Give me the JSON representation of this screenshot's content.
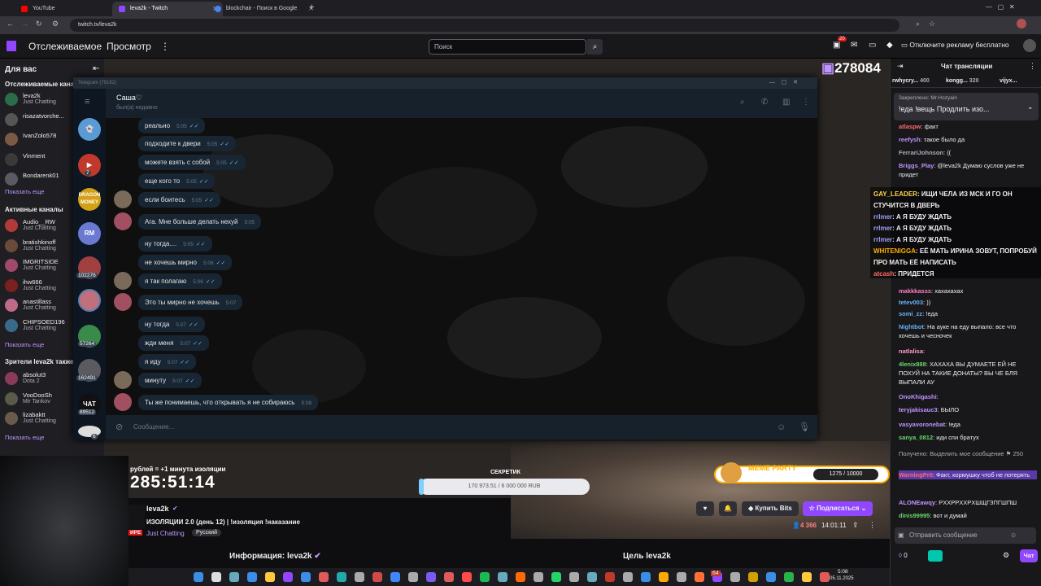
{
  "browser": {
    "tabs": [
      {
        "title": "YouTube",
        "color": "#ff0000"
      },
      {
        "title": "leva2k - Twitch",
        "color": "#9147ff"
      },
      {
        "title": "blockchair - Поиск в Google",
        "color": "#4285f4"
      }
    ],
    "url": "twitch.tv/leva2k"
  },
  "nav": {
    "following": "Отслеживаемое",
    "browse": "Просмотр",
    "search_placeholder": "Поиск",
    "notif_count": "20",
    "adfree": "Отключите рекламу бесплатно"
  },
  "sidebar": {
    "title": "Для вас",
    "followed_header": "Отслеживаемые кана",
    "followed": [
      {
        "name": "leva2k",
        "game": "Just Chatting",
        "color": "#2b6d4a"
      },
      {
        "name": "risazatvorche...",
        "game": "",
        "color": "#555"
      },
      {
        "name": "IvanZolo578",
        "game": "",
        "color": "#7a5a44"
      },
      {
        "name": "Vinment",
        "game": "",
        "color": "#3a3a3a"
      },
      {
        "name": "Bondarenk01",
        "game": "",
        "color": "#5a5a60"
      }
    ],
    "show_more": "Показать еще",
    "active_header": "Активные каналы",
    "active": [
      {
        "name": "Audio__RW",
        "game": "Just Chatting",
        "color": "#b03a3a"
      },
      {
        "name": "bratishkinoff",
        "game": "Just Chatting",
        "color": "#6a4a3a"
      },
      {
        "name": "IMGRITSIDE",
        "game": "Just Chatting",
        "color": "#a04a6a"
      },
      {
        "name": "ihw666",
        "game": "Just Chatting",
        "color": "#7a2020"
      },
      {
        "name": "anastillass",
        "game": "Just Chatting",
        "color": "#c06a8a"
      },
      {
        "name": "CHIPSOED196",
        "game": "Just Chatting",
        "color": "#3a6a8a"
      }
    ],
    "show_more2": "Показать еще",
    "also_header": "Зрители leva2k также",
    "also": [
      {
        "name": "absolut3",
        "game": "Dota 2",
        "color": "#8a3a5a"
      },
      {
        "name": "VooDooSh",
        "game": "Mir Tankov",
        "color": "#5a5a4a"
      },
      {
        "name": "lizabaktt",
        "game": "Just Chatting",
        "color": "#6a5a4a"
      }
    ],
    "show_more3": "Показать еще"
  },
  "telegram": {
    "window_title": "Telegram (79182)",
    "contact": "Саша♡",
    "status": "был(а) недавно",
    "left_badges": [
      "7",
      "102276",
      "57264",
      "162491",
      "89512",
      "6"
    ],
    "left_labels": [
      "RM",
      "ЧАТ"
    ],
    "messages": [
      {
        "text": "реально",
        "time": "5:05",
        "side": "out"
      },
      {
        "text": "подходите к двери",
        "time": "5:05",
        "side": "out"
      },
      {
        "text": "можете взять с собой",
        "time": "5:05",
        "side": "out"
      },
      {
        "text": "еще кого то",
        "time": "5:05",
        "side": "out"
      },
      {
        "text": "если боитесь",
        "time": "5:05",
        "side": "out"
      },
      {
        "text": "Ага. Мне больше делать нехуй",
        "time": "5:05",
        "side": "in"
      },
      {
        "text": "ну тогда....",
        "time": "5:05",
        "side": "out"
      },
      {
        "text": "не хочешь мирно",
        "time": "5:06",
        "side": "out"
      },
      {
        "text": "я так полагаю",
        "time": "5:06",
        "side": "out"
      },
      {
        "text": "Это ты мирно не хочешь",
        "time": "5:07",
        "side": "in"
      },
      {
        "text": "ну тогда",
        "time": "5:07",
        "side": "out"
      },
      {
        "text": "жди меня",
        "time": "5:07",
        "side": "out"
      },
      {
        "text": "я иду",
        "time": "5:07",
        "side": "out"
      },
      {
        "text": "минуту",
        "time": "5:07",
        "side": "out"
      },
      {
        "text": "Ты же понимаешь, что открывать я не собираюсь",
        "time": "5:08",
        "side": "in"
      }
    ],
    "compose_placeholder": "Сообщение..."
  },
  "overlay": {
    "viewer_count": "278084",
    "timer_label": "рублей = +1 минута изоляции",
    "timer": "285:51:14",
    "goal_title": "СЕКРЕТИК",
    "goal_text": "170 973.51 / 6 000 000 RUB",
    "goal_progress": 0.028,
    "meme_title": "MEME PARTY",
    "meme_count": "1275 / 10000"
  },
  "stream": {
    "channel": "leva2k",
    "title": "ИЗОЛЯЦИИ 2.0 (день 12) | !изоляция !наказание",
    "category": "Just Chatting",
    "tag": "Русский",
    "live": "ИРЕ",
    "viewers": "4 366",
    "uptime": "14:01:11",
    "bits_btn": "Купить Bits",
    "subscribe_btn": "Подписаться",
    "about": "Информация: leva2k",
    "goal": "Цель leva2k"
  },
  "chat": {
    "header": "Чат трансляции",
    "top_gifters": [
      {
        "name": "rwhycry...",
        "count": "400"
      },
      {
        "name": "kongg...",
        "count": "320"
      },
      {
        "name": "vijyx...",
        "count": ""
      }
    ],
    "pinned_by": "Закреплено: Mr.Hozyain",
    "pinned_text": "!еда !вещь Продлить изо...",
    "messages": [
      {
        "user": "atlaspw",
        "text": "факт",
        "color": "#ff6a6a"
      },
      {
        "user": "reefysh",
        "text": "такое было да",
        "color": "#bf94ff"
      },
      {
        "user": "FerrariJohnson",
        "text": "((",
        "color": "#adadb8"
      },
      {
        "user": "Briggs_Play",
        "text": "@leva2k Думаю суслов уже не придет",
        "color": "#bf94ff"
      },
      {
        "user": "makkkasss",
        "text": "хахахахах",
        "color": "#ff80c0"
      },
      {
        "user": "tetev003",
        "text": "))",
        "color": "#6ab2f2"
      },
      {
        "user": "somi_zz",
        "text": "!еда",
        "color": "#6ab2f2"
      },
      {
        "user": "Nightbot",
        "text": "На ауке на еду выпало: все что хочешь и чесночек",
        "color": "#6ab2f2"
      },
      {
        "user": "natlalisa",
        "text": "",
        "color": "#ff9acb"
      },
      {
        "user": "4lenix888",
        "text": "ХАХАХА ВЫ ДУМАЕТЕ ЕЙ НЕ ПОХУЙ НА ТАКИЕ ДОНАТЫ? ВЫ ЧЕ БЛЯ ВЫПАЛИ АУ",
        "color": "#6ad66a"
      },
      {
        "user": "OnoKhigashi",
        "text": "",
        "color": "#bf94ff"
      },
      {
        "user": "teryjakisauc3",
        "text": "БЫЛО",
        "color": "#bf94ff"
      },
      {
        "user": "vasyavoronebat",
        "text": "!еда",
        "color": "#bf94ff"
      },
      {
        "user": "sanya_0812",
        "text": "иди спи братух",
        "color": "#6ad66a"
      }
    ],
    "redeem_label": "Получено: Выделить мое сообщение",
    "redeem_cost": "250",
    "highlight_user": "WarningPr0",
    "highlight_text": "Факт, кормушку чтоб не потерять",
    "msg_after": [
      {
        "user": "ALONEawqy",
        "text": "PXXPPXXPXШЩГЗПГШПШ",
        "color": "#bf94ff"
      },
      {
        "user": "dinis99995",
        "text": "вот и думай",
        "color": "#6ad66a"
      }
    ],
    "input_placeholder": "Отправить сообщение",
    "points": "0",
    "send_btn": "Чат"
  },
  "tts": {
    "lines": [
      {
        "user": "GAY_LEADER",
        "text": "ИЩИ ЧЕЛА ИЗ МСК И ГО ОН СТУЧИТСЯ В ДВЕРЬ"
      },
      {
        "user": "rrlmer",
        "text": "А Я БУДУ ЖДАТЬ"
      },
      {
        "user": "rrlmer",
        "text": "А Я БУДУ ЖДАТЬ"
      },
      {
        "user": "rrlmer",
        "text": "А Я БУДУ ЖДАТЬ"
      },
      {
        "user": "WHITENIGGA",
        "text": "ЕЁ МАТЬ ИРИНА ЗОВУТ, ПОПРОБУЙ ПРО МАТЬ ЕЁ НАПИСАТЬ"
      },
      {
        "user": "atcash",
        "text": "ПРИДЕТСЯ"
      }
    ]
  },
  "taskbar": {
    "time": "5:08",
    "date": "05.11.2025",
    "badge": "64"
  }
}
